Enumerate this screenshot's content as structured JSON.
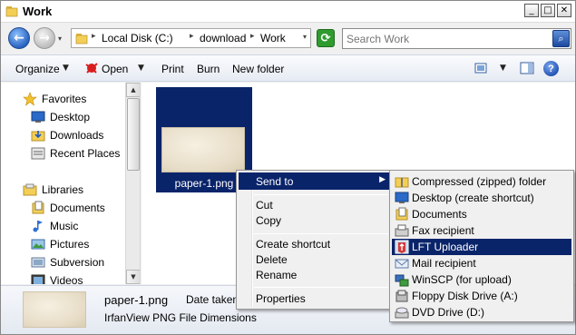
{
  "window": {
    "title": "Work",
    "minimize_glyph": "_",
    "maximize_glyph": "□",
    "close_glyph": "✕"
  },
  "address_bar": {
    "crumbs": [
      "Local Disk (C:)",
      "download",
      "Work"
    ],
    "separator": "▸",
    "dropdown_glyph": "▾"
  },
  "search": {
    "placeholder": "Search Work",
    "value": ""
  },
  "toolbar": {
    "organize_label": "Organize",
    "open_label": "Open",
    "print_label": "Print",
    "burn_label": "Burn",
    "new_folder_label": "New folder",
    "arrow_glyph": "▼"
  },
  "nav": {
    "favorites_label": "Favorites",
    "favorites": [
      "Desktop",
      "Downloads",
      "Recent Places"
    ],
    "libraries_label": "Libraries",
    "libraries": [
      "Documents",
      "Music",
      "Pictures",
      "Subversion",
      "Videos"
    ]
  },
  "content": {
    "file_name": "paper-1.png"
  },
  "details": {
    "file_name": "paper-1.png",
    "date_label": "Date taken",
    "type_text": "IrfanView PNG File Dimensions"
  },
  "context_menu": {
    "send_to": "Send to",
    "submenu_glyph": "▶",
    "cut": "Cut",
    "copy": "Copy",
    "create_shortcut": "Create shortcut",
    "delete": "Delete",
    "rename": "Rename",
    "properties": "Properties"
  },
  "send_to_menu": {
    "items": [
      {
        "label": "Compressed (zipped) folder",
        "icon": "zip-folder-icon"
      },
      {
        "label": "Desktop (create shortcut)",
        "icon": "desktop-icon"
      },
      {
        "label": "Documents",
        "icon": "documents-icon"
      },
      {
        "label": "Fax recipient",
        "icon": "fax-icon"
      },
      {
        "label": "LFT Uploader",
        "icon": "uploader-icon"
      },
      {
        "label": "Mail recipient",
        "icon": "mail-icon"
      },
      {
        "label": "WinSCP (for upload)",
        "icon": "winscp-icon"
      },
      {
        "label": "Floppy Disk Drive (A:)",
        "icon": "floppy-icon"
      },
      {
        "label": "DVD Drive (D:)",
        "icon": "dvd-icon"
      }
    ],
    "highlighted_index": 4
  },
  "colors": {
    "selection": "#0a246a",
    "menu_bg": "#f0f0f0",
    "toolbar_bg": "#e6ebf3"
  }
}
